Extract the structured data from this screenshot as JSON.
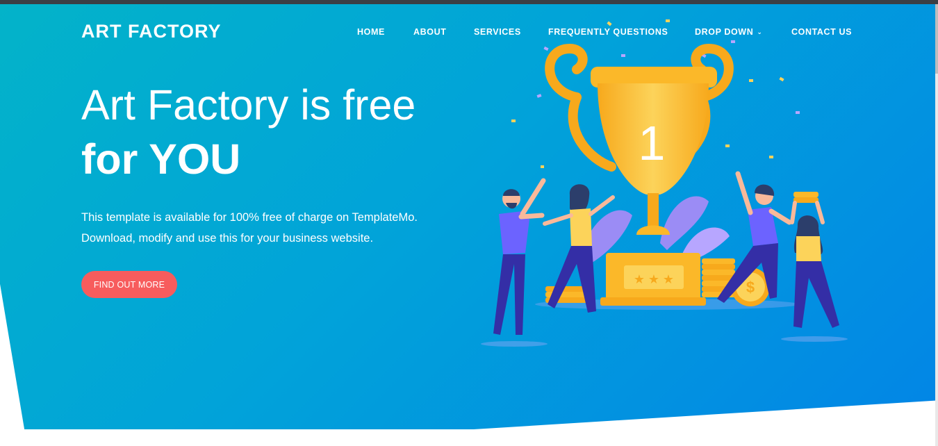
{
  "header": {
    "logo": "ART FACTORY",
    "nav": [
      {
        "label": "HOME"
      },
      {
        "label": "ABOUT"
      },
      {
        "label": "SERVICES"
      },
      {
        "label": "FREQUENTLY QUESTIONS"
      },
      {
        "label": "DROP DOWN",
        "has_dropdown": true
      },
      {
        "label": "CONTACT US"
      }
    ]
  },
  "hero": {
    "headline_line1": "Art Factory is free",
    "headline_line2": "for YOU",
    "description_line1": "This template is available for 100% free of charge on TemplateMo.",
    "description_line2": "Download, modify and use this for your business website.",
    "cta_label": "FIND OUT MORE",
    "trophy_number": "1"
  },
  "colors": {
    "gradient_start": "#03b3c9",
    "gradient_end": "#0285e6",
    "cta": "#f75c5d",
    "trophy": "#fbb829",
    "people_shirt": "#6c63ff"
  }
}
